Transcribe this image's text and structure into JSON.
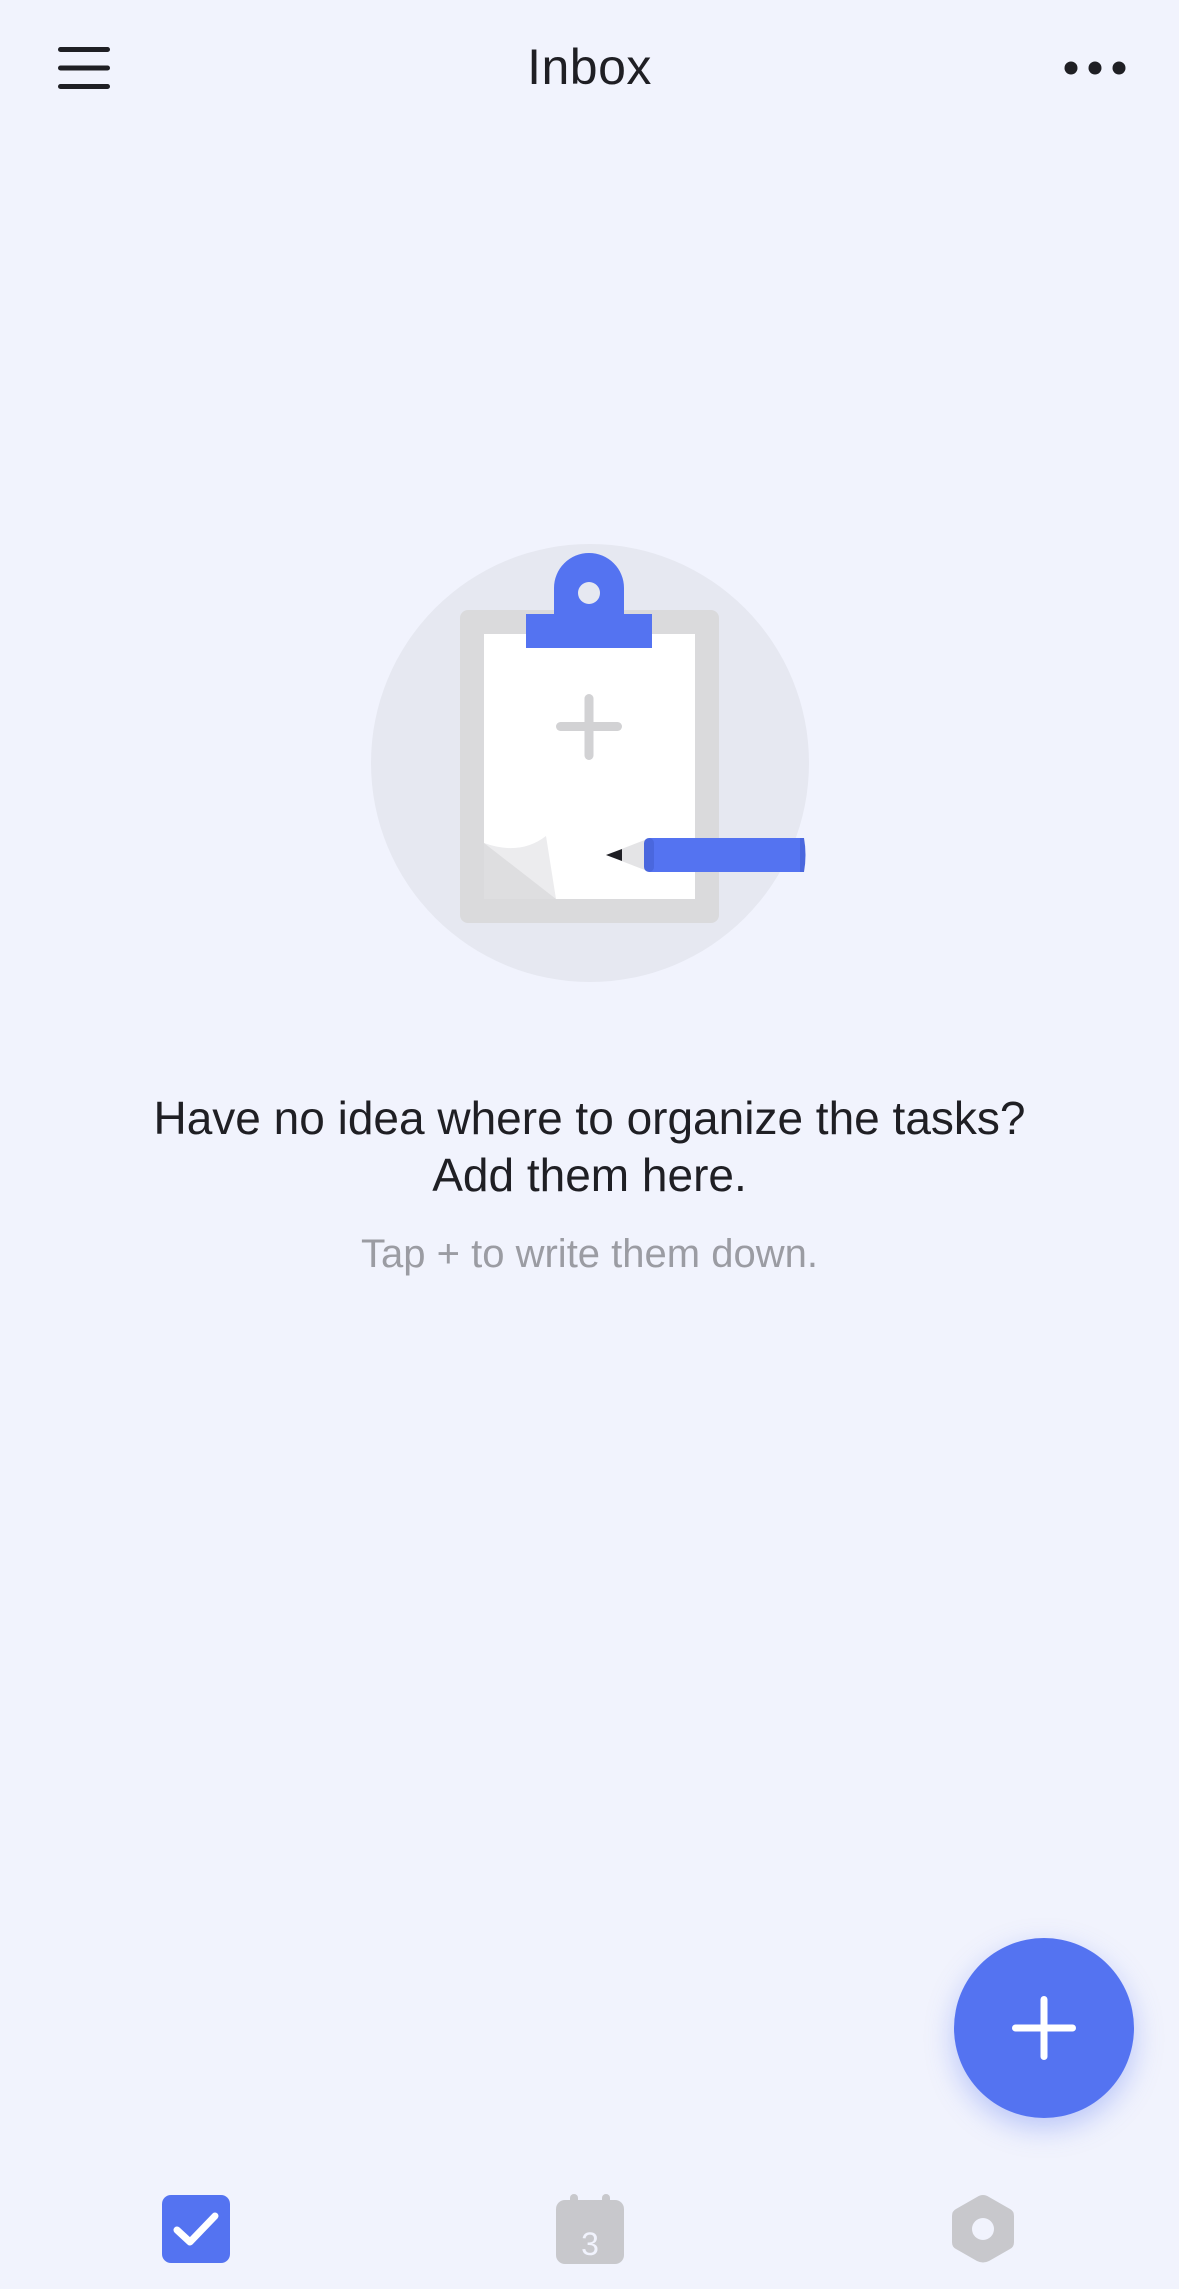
{
  "header": {
    "title": "Inbox",
    "menu_icon": "hamburger-menu-icon",
    "more_icon": "more-horizontal-icon"
  },
  "empty_state": {
    "illustration": "clipboard-pencil-illustration",
    "title": "Have no idea where to organize the tasks? Add them here.",
    "subtitle": "Tap + to write them down."
  },
  "fab": {
    "icon": "plus-icon"
  },
  "tabbar": {
    "items": [
      {
        "icon": "checkbox-icon",
        "active": true
      },
      {
        "icon": "calendar-icon",
        "active": false,
        "day": "3"
      },
      {
        "icon": "settings-hexagon-icon",
        "active": false
      }
    ]
  },
  "colors": {
    "background": "#f1f3fd",
    "accent": "#5473f1",
    "text_primary": "#1f1f24",
    "text_secondary": "#9b9ca3",
    "inactive_icon": "#c8c8cc"
  }
}
